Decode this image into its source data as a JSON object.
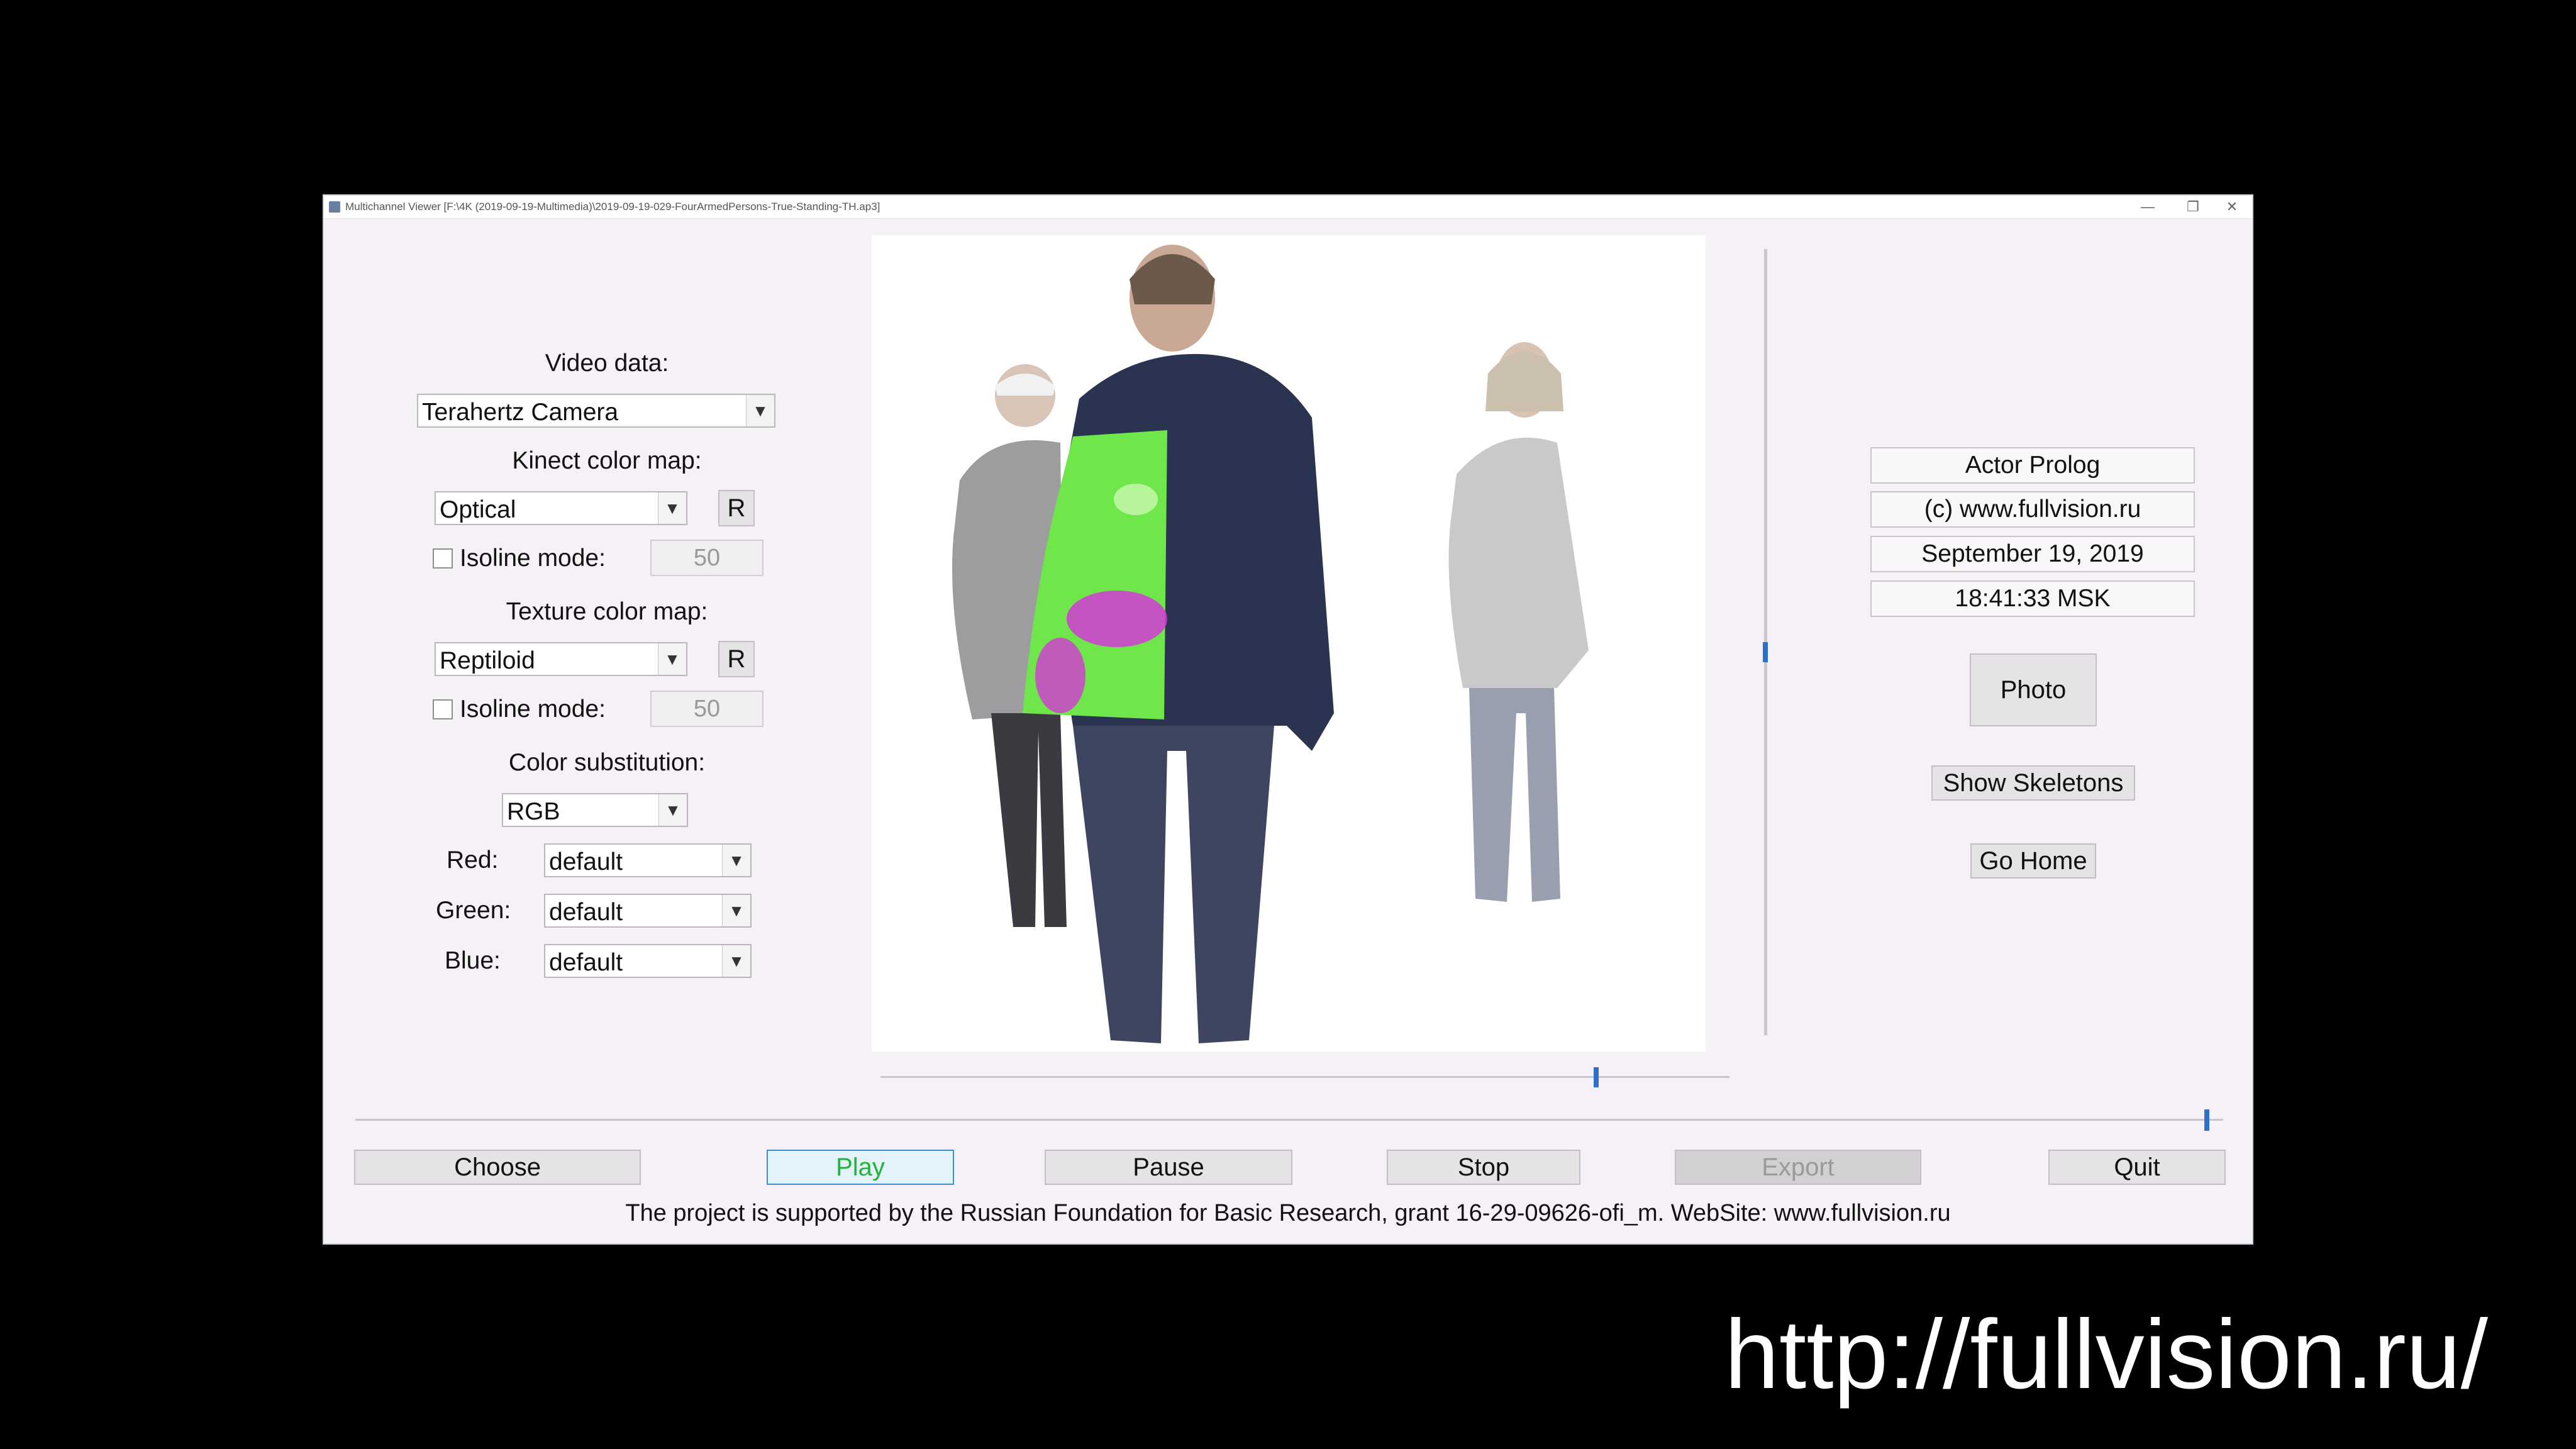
{
  "window": {
    "title": "Multichannel Viewer [F:\\4K (2019-09-19-Multimedia)\\2019-09-19-029-FourArmedPersons-True-Standing-TH.ap3]",
    "minimize_glyph": "—",
    "maximize_glyph": "❐",
    "close_glyph": "✕"
  },
  "left_panel": {
    "video_data_label": "Video data:",
    "video_data_value": "Terahertz Camera",
    "kinect_label": "Kinect color map:",
    "kinect_value": "Optical",
    "kinect_reset": "R",
    "isoline1_label": "Isoline mode:",
    "isoline1_value": "50",
    "texture_label": "Texture color map:",
    "texture_value": "Reptiloid",
    "texture_reset": "R",
    "isoline2_label": "Isoline mode:",
    "isoline2_value": "50",
    "color_sub_label": "Color substitution:",
    "color_sub_value": "RGB",
    "red_label": "Red:",
    "red_value": "default",
    "green_label": "Green:",
    "green_value": "default",
    "blue_label": "Blue:",
    "blue_value": "default"
  },
  "right_panel": {
    "app_name": "Actor Prolog",
    "copyright": "(c) www.fullvision.ru",
    "date": "September 19, 2019",
    "time": "18:41:33 MSK",
    "photo_btn": "Photo",
    "skeletons_btn": "Show Skeletons",
    "home_btn": "Go Home"
  },
  "bottom_bar": {
    "choose": "Choose",
    "play": "Play",
    "pause": "Pause",
    "stop": "Stop",
    "export": "Export",
    "quit": "Quit"
  },
  "footer_text": "The project is supported by the Russian Foundation for Basic Research, grant 16-29-09626-ofi_m. WebSite: www.fullvision.ru",
  "overlay_url": "http://fullvision.ru/",
  "sliders": {
    "video_position": 0.84,
    "timeline_position": 0.99,
    "vertical_position": 0.5
  },
  "colors": {
    "play_text": "#23b23a",
    "play_bg": "#e4f3fb",
    "play_border": "#3b8fd4",
    "thermal_green": "#6fe64a",
    "thermal_magenta": "#d339d6",
    "disabled_text": "#9a9a9a"
  },
  "icons": {
    "dropdown": "▼"
  }
}
